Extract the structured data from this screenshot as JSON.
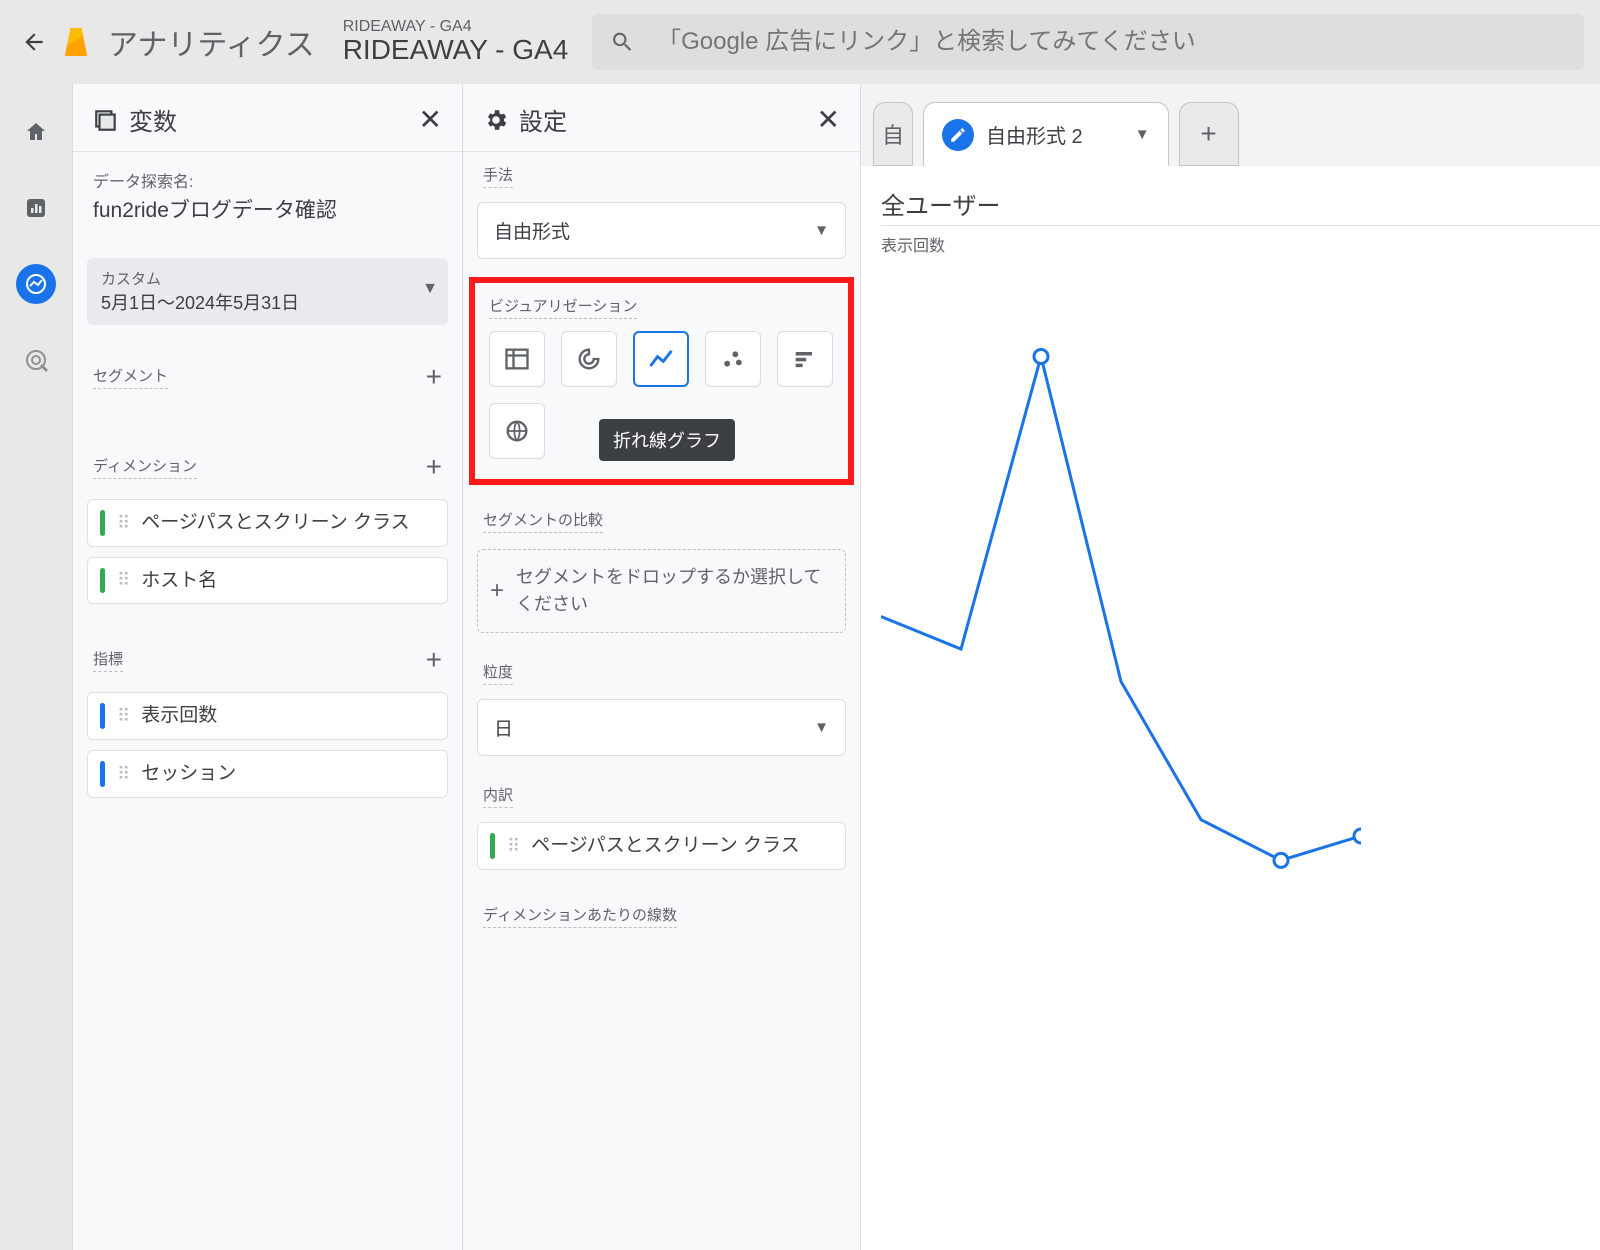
{
  "header": {
    "app_name": "アナリティクス",
    "property_line1": "RIDEAWAY - GA4",
    "property_line2": "RIDEAWAY - GA4",
    "search_placeholder": "「Google 広告にリンク」と検索してみてください"
  },
  "variables": {
    "panel_title": "変数",
    "exploration_label": "データ探索名:",
    "exploration_name": "fun2rideブログデータ確認",
    "date_custom": "カスタム",
    "date_range": "5月1日～2024年5月31日",
    "segments_label": "セグメント",
    "dimensions_label": "ディメンション",
    "dimension_items": [
      "ページパスとスクリーン クラス",
      "ホスト名"
    ],
    "metrics_label": "指標",
    "metric_items": [
      "表示回数",
      "セッション"
    ]
  },
  "settings": {
    "panel_title": "設定",
    "technique_label": "手法",
    "technique_value": "自由形式",
    "visualization_label": "ビジュアリゼーション",
    "tooltip": "折れ線グラフ",
    "segment_compare_label": "セグメントの比較",
    "segment_drop_text": "セグメントをドロップするか選択してください",
    "granularity_label": "粒度",
    "granularity_value": "日",
    "breakdown_label": "内訳",
    "breakdown_item": "ページパスとスクリーン クラス",
    "lines_per_dim_label": "ディメンションあたりの線数"
  },
  "canvas": {
    "tab0_label": "自",
    "active_tab": "自由形式 2",
    "title": "全ユーザー",
    "subtitle": "表示回数"
  },
  "chart_data": {
    "type": "line",
    "series": [
      {
        "name": "全ユーザー",
        "values": [
          430,
          390,
          750,
          350,
          180,
          130,
          160
        ]
      }
    ],
    "x": [
      1,
      2,
      3,
      4,
      5,
      6,
      7
    ],
    "ylabel": "表示回数"
  }
}
